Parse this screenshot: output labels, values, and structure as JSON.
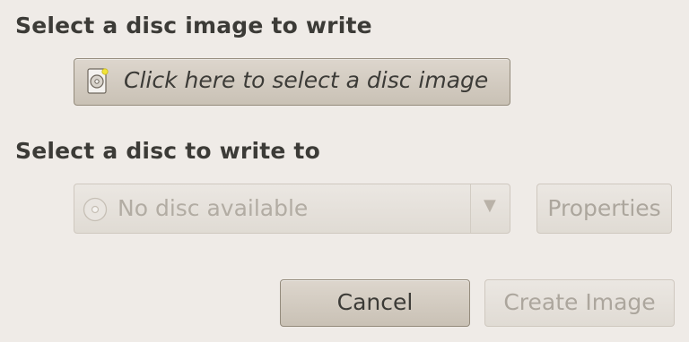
{
  "image_section": {
    "heading": "Select a disc image to write",
    "select_button_label": "Click here to select a disc image",
    "icon": "disc-image-file-icon"
  },
  "disc_section": {
    "heading": "Select a disc to write to",
    "selected_disc": "No disc available",
    "disc_icon": "optical-disc-icon",
    "dropdown_icon": "triangle-down-icon",
    "properties_label": "Properties"
  },
  "actions": {
    "cancel_label": "Cancel",
    "create_label": "Create Image"
  }
}
